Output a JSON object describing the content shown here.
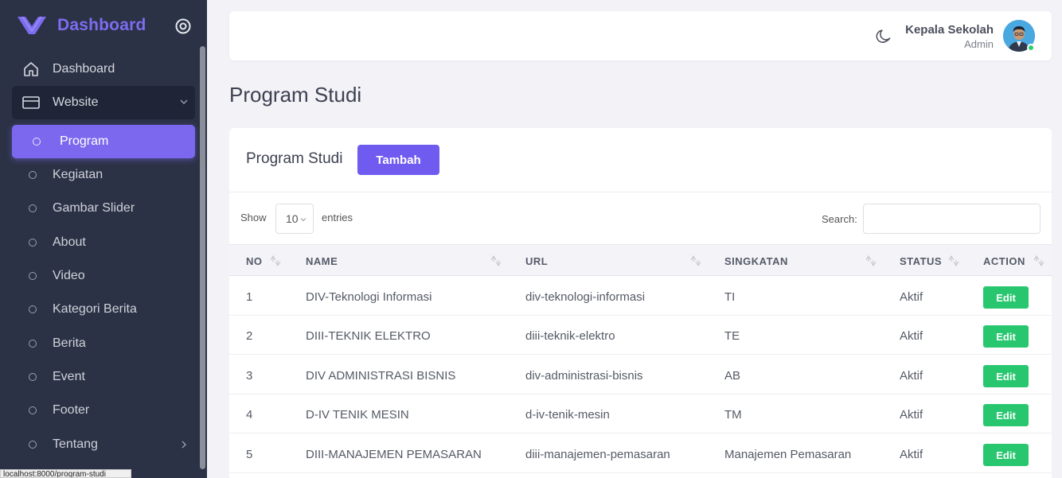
{
  "sidebar": {
    "brand": "Dashboard",
    "items": [
      {
        "label": "Dashboard",
        "icon": "home-icon"
      },
      {
        "label": "Website",
        "icon": "card-icon"
      }
    ],
    "subitems": [
      {
        "label": "Program",
        "active": true
      },
      {
        "label": "Kegiatan"
      },
      {
        "label": "Gambar Slider"
      },
      {
        "label": "About"
      },
      {
        "label": "Video"
      },
      {
        "label": "Kategori Berita"
      },
      {
        "label": "Berita"
      },
      {
        "label": "Event"
      },
      {
        "label": "Footer"
      },
      {
        "label": "Tentang"
      }
    ]
  },
  "statusbar": {
    "url": "localhost:8000/program-studi"
  },
  "header": {
    "user_name": "Kepala Sekolah",
    "user_role": "Admin"
  },
  "page": {
    "title": "Program Studi"
  },
  "card": {
    "title": "Program Studi",
    "add_label": "Tambah",
    "show_label": "Show",
    "page_length": "10",
    "entries_label": "entries",
    "search_label": "Search:",
    "search_value": ""
  },
  "table": {
    "columns": [
      "NO",
      "NAME",
      "URL",
      "SINGKATAN",
      "STATUS",
      "ACTION"
    ],
    "rows": [
      {
        "no": "1",
        "name": "DIV-Teknologi Informasi",
        "url": "div-teknologi-informasi",
        "singkatan": "TI",
        "status": "Aktif",
        "action": "Edit"
      },
      {
        "no": "2",
        "name": "DIII-TEKNIK ELEKTRO",
        "url": "diii-teknik-elektro",
        "singkatan": "TE",
        "status": "Aktif",
        "action": "Edit"
      },
      {
        "no": "3",
        "name": "DIV ADMINISTRASI BISNIS",
        "url": "div-administrasi-bisnis",
        "singkatan": "AB",
        "status": "Aktif",
        "action": "Edit"
      },
      {
        "no": "4",
        "name": "D-IV TENIK MESIN",
        "url": "d-iv-tenik-mesin",
        "singkatan": "TM",
        "status": "Aktif",
        "action": "Edit"
      },
      {
        "no": "5",
        "name": "DIII-MANAJEMEN PEMASARAN",
        "url": "diii-manajemen-pemasaran",
        "singkatan": "Manajemen Pemasaran",
        "status": "Aktif",
        "action": "Edit"
      }
    ]
  },
  "colors": {
    "sidebar_bg": "#2b3245",
    "accent": "#7b68ee",
    "success": "#28c76f",
    "page_bg": "#f2f2f7"
  }
}
